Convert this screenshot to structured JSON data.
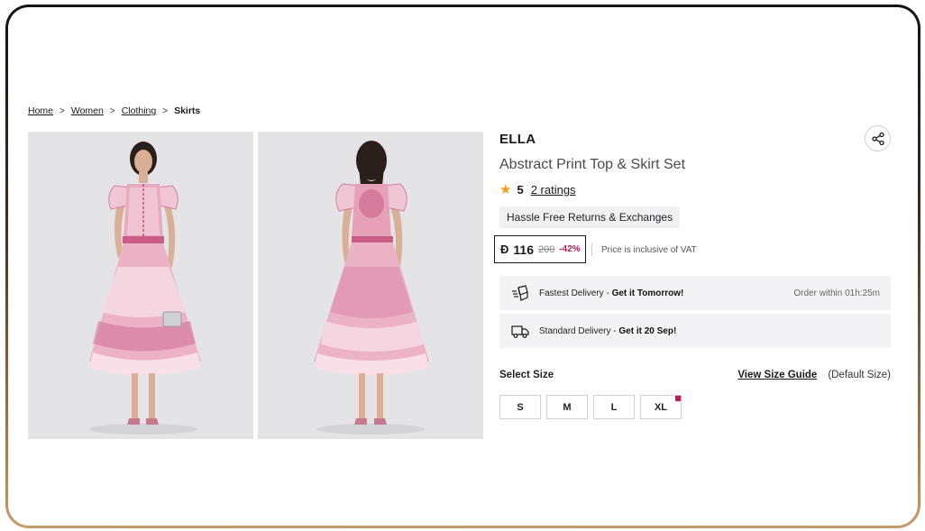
{
  "breadcrumb": {
    "items": [
      "Home",
      "Women",
      "Clothing"
    ],
    "separator": ">",
    "current": "Skirts"
  },
  "product": {
    "brand": "ELLA",
    "title": "Abstract Print Top & Skirt Set",
    "rating": {
      "score": "5",
      "count_label": "2 ratings",
      "star_icon": "star-icon"
    },
    "returns_badge": "Hassle Free Returns & Exchanges",
    "price": {
      "currency_symbol": "Đ",
      "current": "116",
      "original": "200",
      "discount": "-42%",
      "vat_note": "Price is inclusive of VAT"
    },
    "delivery": [
      {
        "icon": "fast-box-icon",
        "prefix": "Fastest Delivery - ",
        "highlight": "Get it Tomorrow!",
        "right": "Order within 01h:25m"
      },
      {
        "icon": "truck-icon",
        "prefix": "Standard Delivery - ",
        "highlight": "Get it 20 Sep!",
        "right": ""
      }
    ],
    "size": {
      "label": "Select Size",
      "guide_link": "View Size Guide",
      "default_note": "(Default Size)",
      "options": [
        "S",
        "M",
        "L",
        "XL"
      ],
      "low_stock_option": "XL"
    }
  },
  "colors": {
    "star": "#f29b1b",
    "discount": "#c2185b",
    "dress_pink": "#e9a9c0"
  }
}
